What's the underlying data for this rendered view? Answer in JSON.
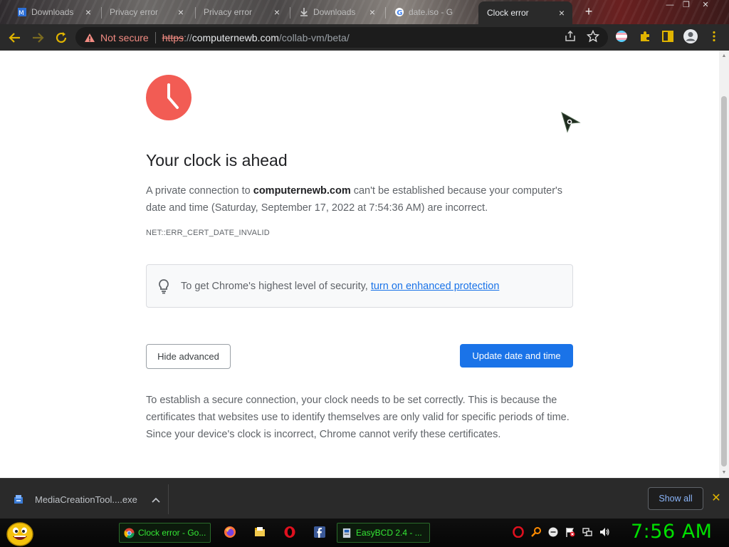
{
  "browser": {
    "tabs": [
      {
        "title": "Downloads",
        "active": false
      },
      {
        "title": "Privacy error",
        "active": false
      },
      {
        "title": "Privacy error",
        "active": false
      },
      {
        "title": "Downloads",
        "active": false
      },
      {
        "title": "date.iso - G",
        "active": false
      },
      {
        "title": "Clock error",
        "active": true
      }
    ],
    "new_tab_label": "+",
    "address": {
      "security_label": "Not secure",
      "scheme": "https",
      "scheme_sep": "://",
      "host": "computernewb.com",
      "path": "/collab-vm/beta/"
    }
  },
  "page": {
    "headline": "Your clock is ahead",
    "explanation": {
      "before": "A private connection to ",
      "domain": "computernewb.com",
      "after": " can't be established because your computer's date and time (Saturday, September 17, 2022 at 7:54:36 AM) are incorrect."
    },
    "error_code": "NET::ERR_CERT_DATE_INVALID",
    "promo": {
      "text": "To get Chrome's highest level of security,",
      "link": "turn on enhanced protection"
    },
    "hide_advanced_label": "Hide advanced",
    "update_button_label": "Update date and time",
    "details": "To establish a secure connection, your clock needs to be set correctly. This is because the certificates that websites use to identify themselves are only valid for specific periods of time. Since your device's clock is incorrect, Chrome cannot verify these certificates."
  },
  "downloads": {
    "filename": "MediaCreationTool....exe",
    "show_all_label": "Show all"
  },
  "taskbar": {
    "buttons": [
      {
        "label": "Clock error - Go..."
      },
      {
        "label": "EasyBCD 2.4 - ..."
      }
    ],
    "clock": "7:56 AM"
  },
  "colors": {
    "accent_blue": "#1a73e8",
    "clock_red": "#f25c54",
    "not_secure_red": "#f28b82",
    "taskbar_green": "#35e835"
  },
  "icons": [
    "warning-icon",
    "share-icon",
    "star-icon",
    "extensions-icon",
    "profile-icon",
    "lightbulb-icon",
    "clock-icon"
  ]
}
